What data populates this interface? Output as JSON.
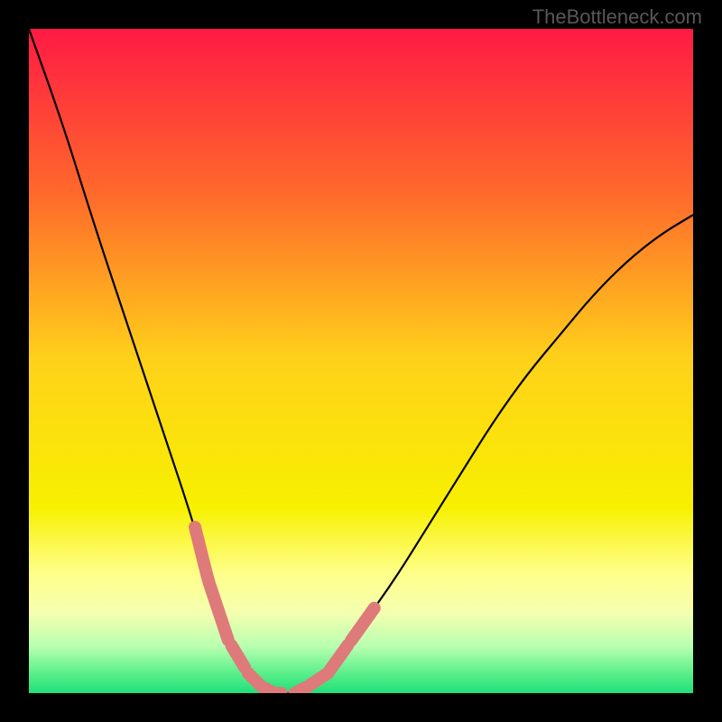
{
  "watermark": "TheBottleneck.com",
  "chart_data": {
    "type": "line",
    "title": "",
    "xlabel": "",
    "ylabel": "",
    "xlim": [
      0,
      100
    ],
    "ylim": [
      0,
      100
    ],
    "series": [
      {
        "name": "bottleneck-curve",
        "x": [
          0,
          5,
          10,
          15,
          20,
          25,
          27,
          30,
          33,
          35,
          37,
          39,
          40,
          42,
          45,
          50,
          55,
          60,
          65,
          70,
          75,
          80,
          85,
          90,
          95,
          100
        ],
        "y": [
          100,
          86,
          70,
          55,
          40,
          25,
          17,
          8,
          3,
          1,
          0,
          0,
          0,
          1,
          3,
          10,
          17,
          25,
          33,
          41,
          48,
          54,
          60,
          65,
          69,
          72
        ]
      }
    ],
    "highlight_segments": {
      "name": "marker-dashes",
      "ranges_x": [
        [
          25,
          30
        ],
        [
          30.5,
          32.5
        ],
        [
          33,
          38
        ],
        [
          40,
          44
        ],
        [
          44.5,
          48
        ],
        [
          48.5,
          52
        ]
      ],
      "color": "#de7a7a"
    },
    "background_gradient": {
      "stops": [
        {
          "offset": 0,
          "color": "#ff1a44"
        },
        {
          "offset": 25,
          "color": "#ff6a2b"
        },
        {
          "offset": 50,
          "color": "#ffd21a"
        },
        {
          "offset": 72,
          "color": "#f7f000"
        },
        {
          "offset": 82,
          "color": "#ffff8a"
        },
        {
          "offset": 88,
          "color": "#f4ffb0"
        },
        {
          "offset": 93,
          "color": "#b8ffb0"
        },
        {
          "offset": 97,
          "color": "#5aef8a"
        },
        {
          "offset": 100,
          "color": "#1fe07a"
        }
      ]
    }
  }
}
